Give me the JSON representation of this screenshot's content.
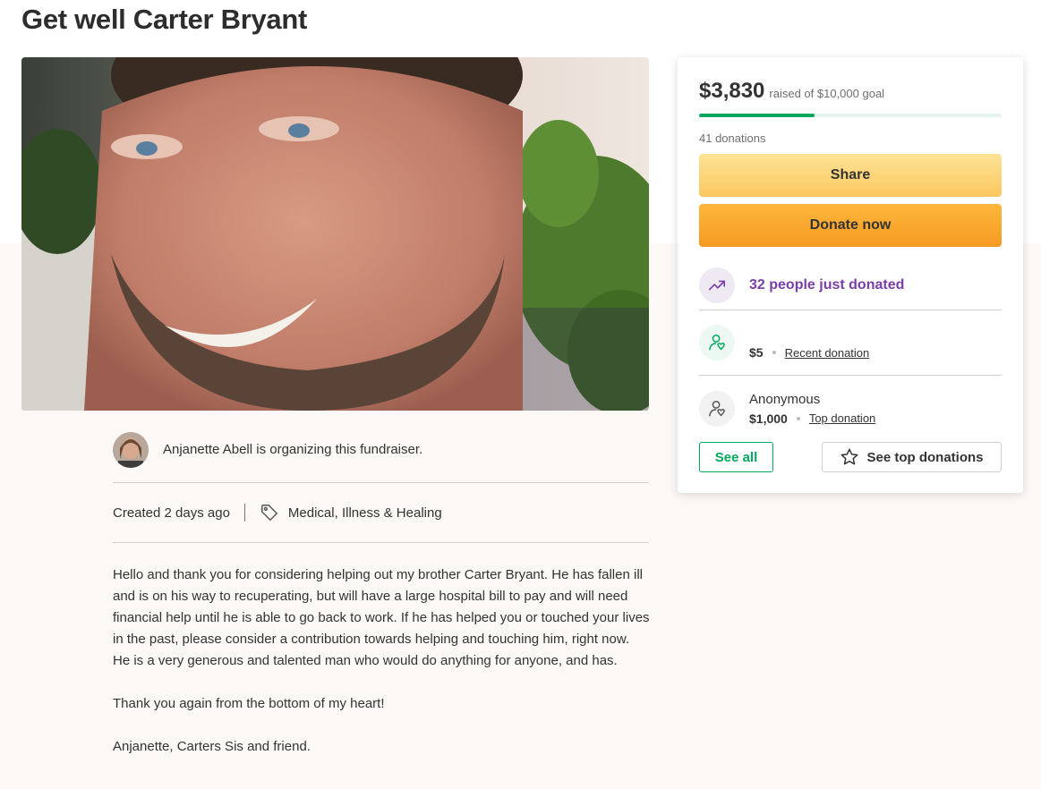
{
  "page": {
    "title": "Get well Carter Bryant"
  },
  "organizer": {
    "text": "Anjanette Abell is organizing this fundraiser."
  },
  "meta": {
    "created": "Created 2 days ago",
    "category": "Medical, Illness & Healing"
  },
  "story": {
    "paragraphs": [
      "Hello and thank you for considering helping out my brother Carter Bryant. He has fallen ill and is on his way to recuperating, but will have a large hospital bill to pay and will need financial help until he is able to go back to work. If he has helped you or touched your lives in the past, please consider a contribution towards helping and touching him, right now. He is a very generous and talented man who would do anything for anyone, and has.",
      "Thank you again from the bottom of my heart!",
      "Anjanette, Carters Sis and friend."
    ]
  },
  "donate_card": {
    "raised": "$3,830",
    "goal_text": "raised of $10,000 goal",
    "progress_fraction": 0.383,
    "donation_count": "41 donations",
    "share_label": "Share",
    "donate_label": "Donate now",
    "trending_text": "32 people just donated",
    "recent": {
      "name": "",
      "amount": "$5",
      "label": "Recent donation"
    },
    "top": {
      "name": "Anonymous",
      "amount": "$1,000",
      "label": "Top donation"
    },
    "see_all_label": "See all",
    "see_top_label": "See top donations"
  },
  "colors": {
    "accent_green": "#02a95c",
    "trend_purple": "#7a3ea8",
    "donate_orange": "#f79a22",
    "share_yellow": "#fbc85f"
  }
}
